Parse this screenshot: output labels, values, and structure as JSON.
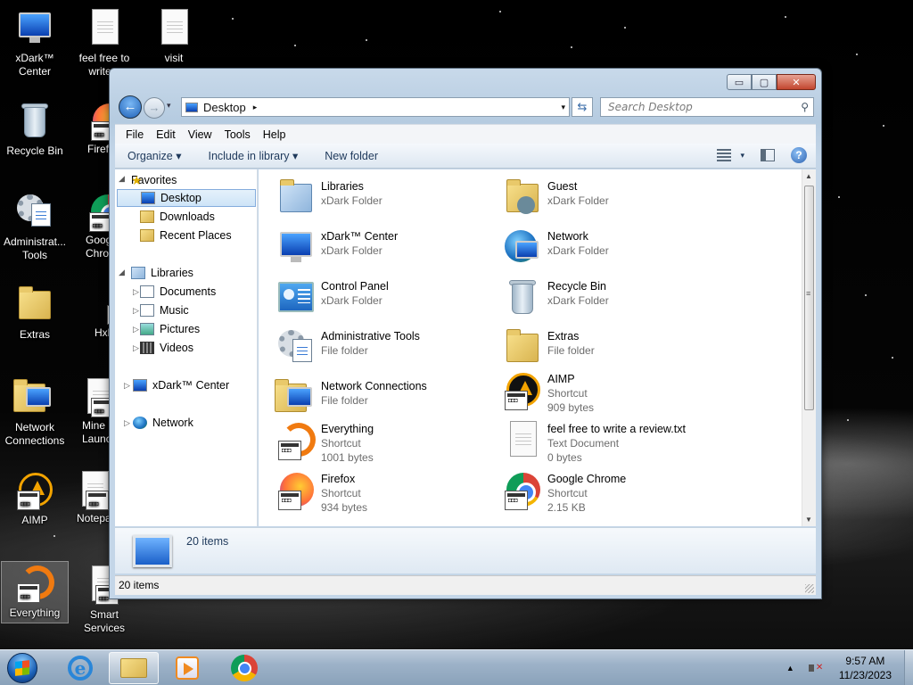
{
  "desktop": {
    "icons": [
      {
        "label": "xDark™\nCenter",
        "icon": "monitor-icon"
      },
      {
        "label": "feel free to\nwrite a",
        "icon": "text-file-icon"
      },
      {
        "label": "visit",
        "icon": "text-file-icon"
      },
      {
        "label": "Recycle Bin",
        "icon": "recycle-bin-icon"
      },
      {
        "label": "Firef",
        "icon": "firefox-shortcut-icon"
      },
      {
        "label": "Administrat...\nTools",
        "icon": "admin-tools-icon"
      },
      {
        "label": "Goog\nChro",
        "icon": "chrome-shortcut-icon"
      },
      {
        "label": "Extras",
        "icon": "folder-icon"
      },
      {
        "label": "Hxl",
        "icon": "shortcut-icon"
      },
      {
        "label": "Network\nConnections",
        "icon": "network-connections-icon"
      },
      {
        "label": "Mine\nLaunc",
        "icon": "shortcut-icon"
      },
      {
        "label": "AIMP",
        "icon": "aimp-shortcut-icon"
      },
      {
        "label": "Notepa",
        "icon": "shortcut-icon"
      },
      {
        "label": "Everything",
        "icon": "everything-shortcut-icon"
      },
      {
        "label": "Smart\nServices",
        "icon": "shortcut-icon"
      }
    ]
  },
  "window": {
    "title_buttons": {
      "minimize": "▭",
      "maximize": "▢",
      "close": "✕"
    },
    "address": {
      "location": "Desktop",
      "separator": "▸",
      "dropdown": "▾"
    },
    "search_placeholder": "Search Desktop",
    "menu": [
      "File",
      "Edit",
      "View",
      "Tools",
      "Help"
    ],
    "commands": {
      "organize": "Organize ▾",
      "include": "Include in library ▾",
      "new_folder": "New folder"
    },
    "nav": {
      "favorites": "Favorites",
      "desktop": "Desktop",
      "downloads": "Downloads",
      "recent": "Recent Places",
      "libraries": "Libraries",
      "documents": "Documents",
      "music": "Music",
      "pictures": "Pictures",
      "videos": "Videos",
      "xdark": "xDark™ Center",
      "network": "Network"
    },
    "items": [
      {
        "name": "Libraries",
        "type": "xDark Folder",
        "size": "",
        "icon": "libraries-icon"
      },
      {
        "name": "Guest",
        "type": "xDark Folder",
        "size": "",
        "icon": "user-folder-icon"
      },
      {
        "name": "xDark™ Center",
        "type": "xDark Folder",
        "size": "",
        "icon": "monitor-icon"
      },
      {
        "name": "Network",
        "type": "xDark Folder",
        "size": "",
        "icon": "network-globe-icon"
      },
      {
        "name": "Control Panel",
        "type": "xDark Folder",
        "size": "",
        "icon": "control-panel-icon"
      },
      {
        "name": "Recycle Bin",
        "type": "xDark Folder",
        "size": "",
        "icon": "recycle-bin-icon"
      },
      {
        "name": "Administrative Tools",
        "type": "File folder",
        "size": "",
        "icon": "admin-tools-icon"
      },
      {
        "name": "Extras",
        "type": "File folder",
        "size": "",
        "icon": "folder-icon"
      },
      {
        "name": "Network Connections",
        "type": "File folder",
        "size": "",
        "icon": "network-connections-icon"
      },
      {
        "name": "AIMP",
        "type": "Shortcut",
        "size": "909 bytes",
        "icon": "aimp-shortcut-icon"
      },
      {
        "name": "Everything",
        "type": "Shortcut",
        "size": "1001 bytes",
        "icon": "everything-shortcut-icon"
      },
      {
        "name": "feel free to write a review.txt",
        "type": "Text Document",
        "size": "0 bytes",
        "icon": "text-file-icon"
      },
      {
        "name": "Firefox",
        "type": "Shortcut",
        "size": "934 bytes",
        "icon": "firefox-shortcut-icon"
      },
      {
        "name": "Google Chrome",
        "type": "Shortcut",
        "size": "2.15 KB",
        "icon": "chrome-shortcut-icon"
      }
    ],
    "details_count": "20 items",
    "status_count": "20 items"
  },
  "taskbar": {
    "apps": [
      "internet-explorer",
      "windows-explorer",
      "media-player",
      "google-chrome"
    ],
    "tray_expand": "▲",
    "time": "9:57 AM",
    "date": "11/23/2023"
  }
}
